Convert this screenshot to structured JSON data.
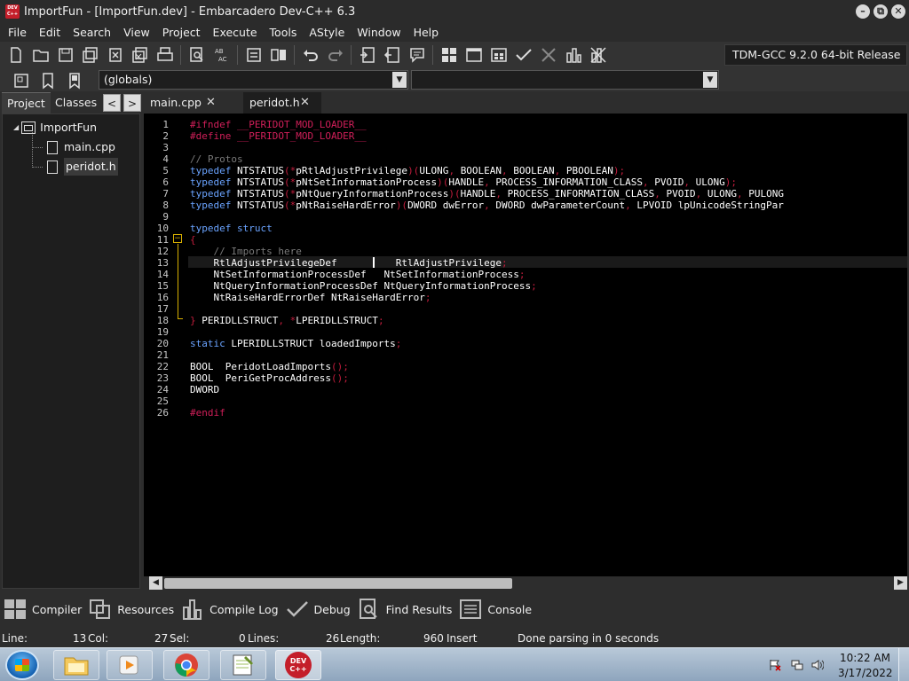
{
  "window": {
    "title": "ImportFun - [ImportFun.dev] - Embarcadero Dev-C++ 6.3",
    "app_icon_text": "DEV C++",
    "min": "–",
    "max": "⧉",
    "close": "✕"
  },
  "menu": [
    "File",
    "Edit",
    "Search",
    "View",
    "Project",
    "Execute",
    "Tools",
    "AStyle",
    "Window",
    "Help"
  ],
  "toolbar": {
    "compiler": "TDM-GCC 9.2.0 64-bit Release",
    "globals": "(globals)",
    "second_combo": ""
  },
  "left_panel": {
    "tabs": [
      "Project",
      "Classes"
    ],
    "prev": "<",
    "next": ">",
    "project": "ImportFun",
    "files": [
      "main.cpp",
      "peridot.h"
    ]
  },
  "editor_tabs": [
    {
      "label": "main.cpp",
      "close": "✕"
    },
    {
      "label": "peridot.h",
      "close": "✕"
    }
  ],
  "code": {
    "line_numbers": [
      "1",
      "2",
      "3",
      "4",
      "5",
      "6",
      "7",
      "8",
      "9",
      "10",
      "11",
      "12",
      "13",
      "14",
      "15",
      "16",
      "17",
      "18",
      "19",
      "20",
      "21",
      "22",
      "23",
      "24",
      "25",
      "26"
    ],
    "lines": [
      [
        {
          "c": "pp",
          "t": "#ifndef __PERIDOT_MOD_LOADER__"
        }
      ],
      [
        {
          "c": "pp",
          "t": "#define __PERIDOT_MOD_LOADER__"
        }
      ],
      [],
      [
        {
          "c": "cm",
          "t": "// Protos"
        }
      ],
      [
        {
          "c": "kw",
          "t": "typedef "
        },
        {
          "c": "id",
          "t": "NTSTATUS"
        },
        {
          "c": "sym",
          "t": "(*"
        },
        {
          "c": "id",
          "t": "pRtlAdjustPrivilege"
        },
        {
          "c": "sym",
          "t": ")("
        },
        {
          "c": "id",
          "t": "ULONG"
        },
        {
          "c": "sym",
          "t": ", "
        },
        {
          "c": "id",
          "t": "BOOLEAN"
        },
        {
          "c": "sym",
          "t": ", "
        },
        {
          "c": "id",
          "t": "BOOLEAN"
        },
        {
          "c": "sym",
          "t": ", "
        },
        {
          "c": "id",
          "t": "PBOOLEAN"
        },
        {
          "c": "sym",
          "t": ");"
        }
      ],
      [
        {
          "c": "kw",
          "t": "typedef "
        },
        {
          "c": "id",
          "t": "NTSTATUS"
        },
        {
          "c": "sym",
          "t": "(*"
        },
        {
          "c": "id",
          "t": "pNtSetInformationProcess"
        },
        {
          "c": "sym",
          "t": ")("
        },
        {
          "c": "id",
          "t": "HANDLE"
        },
        {
          "c": "sym",
          "t": ", "
        },
        {
          "c": "id",
          "t": "PROCESS_INFORMATION_CLASS"
        },
        {
          "c": "sym",
          "t": ", "
        },
        {
          "c": "id",
          "t": "PVOID"
        },
        {
          "c": "sym",
          "t": ", "
        },
        {
          "c": "id",
          "t": "ULONG"
        },
        {
          "c": "sym",
          "t": ");"
        }
      ],
      [
        {
          "c": "kw",
          "t": "typedef "
        },
        {
          "c": "id",
          "t": "NTSTATUS"
        },
        {
          "c": "sym",
          "t": "(*"
        },
        {
          "c": "id",
          "t": "pNtQueryInformationProcess"
        },
        {
          "c": "sym",
          "t": ")("
        },
        {
          "c": "id",
          "t": "HANDLE"
        },
        {
          "c": "sym",
          "t": ", "
        },
        {
          "c": "id",
          "t": "PROCESS_INFORMATION_CLASS"
        },
        {
          "c": "sym",
          "t": ", "
        },
        {
          "c": "id",
          "t": "PVOID"
        },
        {
          "c": "sym",
          "t": ", "
        },
        {
          "c": "id",
          "t": "ULONG"
        },
        {
          "c": "sym",
          "t": ", "
        },
        {
          "c": "id",
          "t": "PULONG"
        }
      ],
      [
        {
          "c": "kw",
          "t": "typedef "
        },
        {
          "c": "id",
          "t": "NTSTATUS"
        },
        {
          "c": "sym",
          "t": "(*"
        },
        {
          "c": "id",
          "t": "pNtRaiseHardError"
        },
        {
          "c": "sym",
          "t": ")("
        },
        {
          "c": "id",
          "t": "DWORD dwError"
        },
        {
          "c": "sym",
          "t": ", "
        },
        {
          "c": "id",
          "t": "DWORD dwParameterCount"
        },
        {
          "c": "sym",
          "t": ", "
        },
        {
          "c": "id",
          "t": "LPVOID lpUnicodeStringPar"
        }
      ],
      [],
      [
        {
          "c": "kw",
          "t": "typedef struct"
        }
      ],
      [
        {
          "c": "sym",
          "t": "{"
        }
      ],
      [
        {
          "c": "cm",
          "t": "    // Imports here"
        }
      ],
      [
        {
          "c": "id",
          "t": "    RtlAdjustPrivilegeDef          RtlAdjustPrivilege"
        },
        {
          "c": "sym",
          "t": ";"
        }
      ],
      [
        {
          "c": "id",
          "t": "    NtSetInformationProcessDef   NtSetInformationProcess"
        },
        {
          "c": "sym",
          "t": ";"
        }
      ],
      [
        {
          "c": "id",
          "t": "    NtQueryInformationProcessDef"
        },
        {
          "c": "sym",
          "t": " "
        },
        {
          "c": "id",
          "t": "NtQueryInformationProcess"
        },
        {
          "c": "sym",
          "t": ";"
        }
      ],
      [
        {
          "c": "id",
          "t": "    NtRaiseHardErrorDef NtRaiseHardError"
        },
        {
          "c": "sym",
          "t": ";"
        }
      ],
      [],
      [
        {
          "c": "sym",
          "t": "} "
        },
        {
          "c": "id",
          "t": "PERIDLLSTRUCT"
        },
        {
          "c": "sym",
          "t": ", *"
        },
        {
          "c": "id",
          "t": "LPERIDLLSTRUCT"
        },
        {
          "c": "sym",
          "t": ";"
        }
      ],
      [],
      [
        {
          "c": "kw",
          "t": "static "
        },
        {
          "c": "id",
          "t": "LPERIDLLSTRUCT loadedImports"
        },
        {
          "c": "sym",
          "t": ";"
        }
      ],
      [],
      [
        {
          "c": "id",
          "t": "BOOL  PeridotLoadImports"
        },
        {
          "c": "sym",
          "t": "();"
        }
      ],
      [
        {
          "c": "id",
          "t": "BOOL  PeriGetProcAddress"
        },
        {
          "c": "sym",
          "t": "();"
        }
      ],
      [
        {
          "c": "id",
          "t": "DWORD"
        }
      ],
      [],
      [
        {
          "c": "pp",
          "t": "#endif"
        }
      ]
    ]
  },
  "bottom_tabs": [
    "Compiler",
    "Resources",
    "Compile Log",
    "Debug",
    "Find Results",
    "Console"
  ],
  "status": {
    "line_label": "Line:",
    "line_val": "13",
    "col_label": "Col:",
    "col_val": "27",
    "sel_label": "Sel:",
    "sel_val": "0",
    "lines_label": "Lines:",
    "lines_val": "26",
    "length_label": "Length:",
    "length_val": "960",
    "mode": "Insert",
    "message": "Done parsing in 0 seconds"
  },
  "taskbar": {
    "time": "10:22 AM",
    "date": "3/17/2022",
    "devcpp_label": "DEV C++"
  },
  "colors": {
    "preprocessor": "#d21f5a",
    "keyword": "#6aa3ff",
    "comment": "#7a7a7a",
    "symbol": "#c01c3c",
    "editor_bg": "#000000"
  }
}
